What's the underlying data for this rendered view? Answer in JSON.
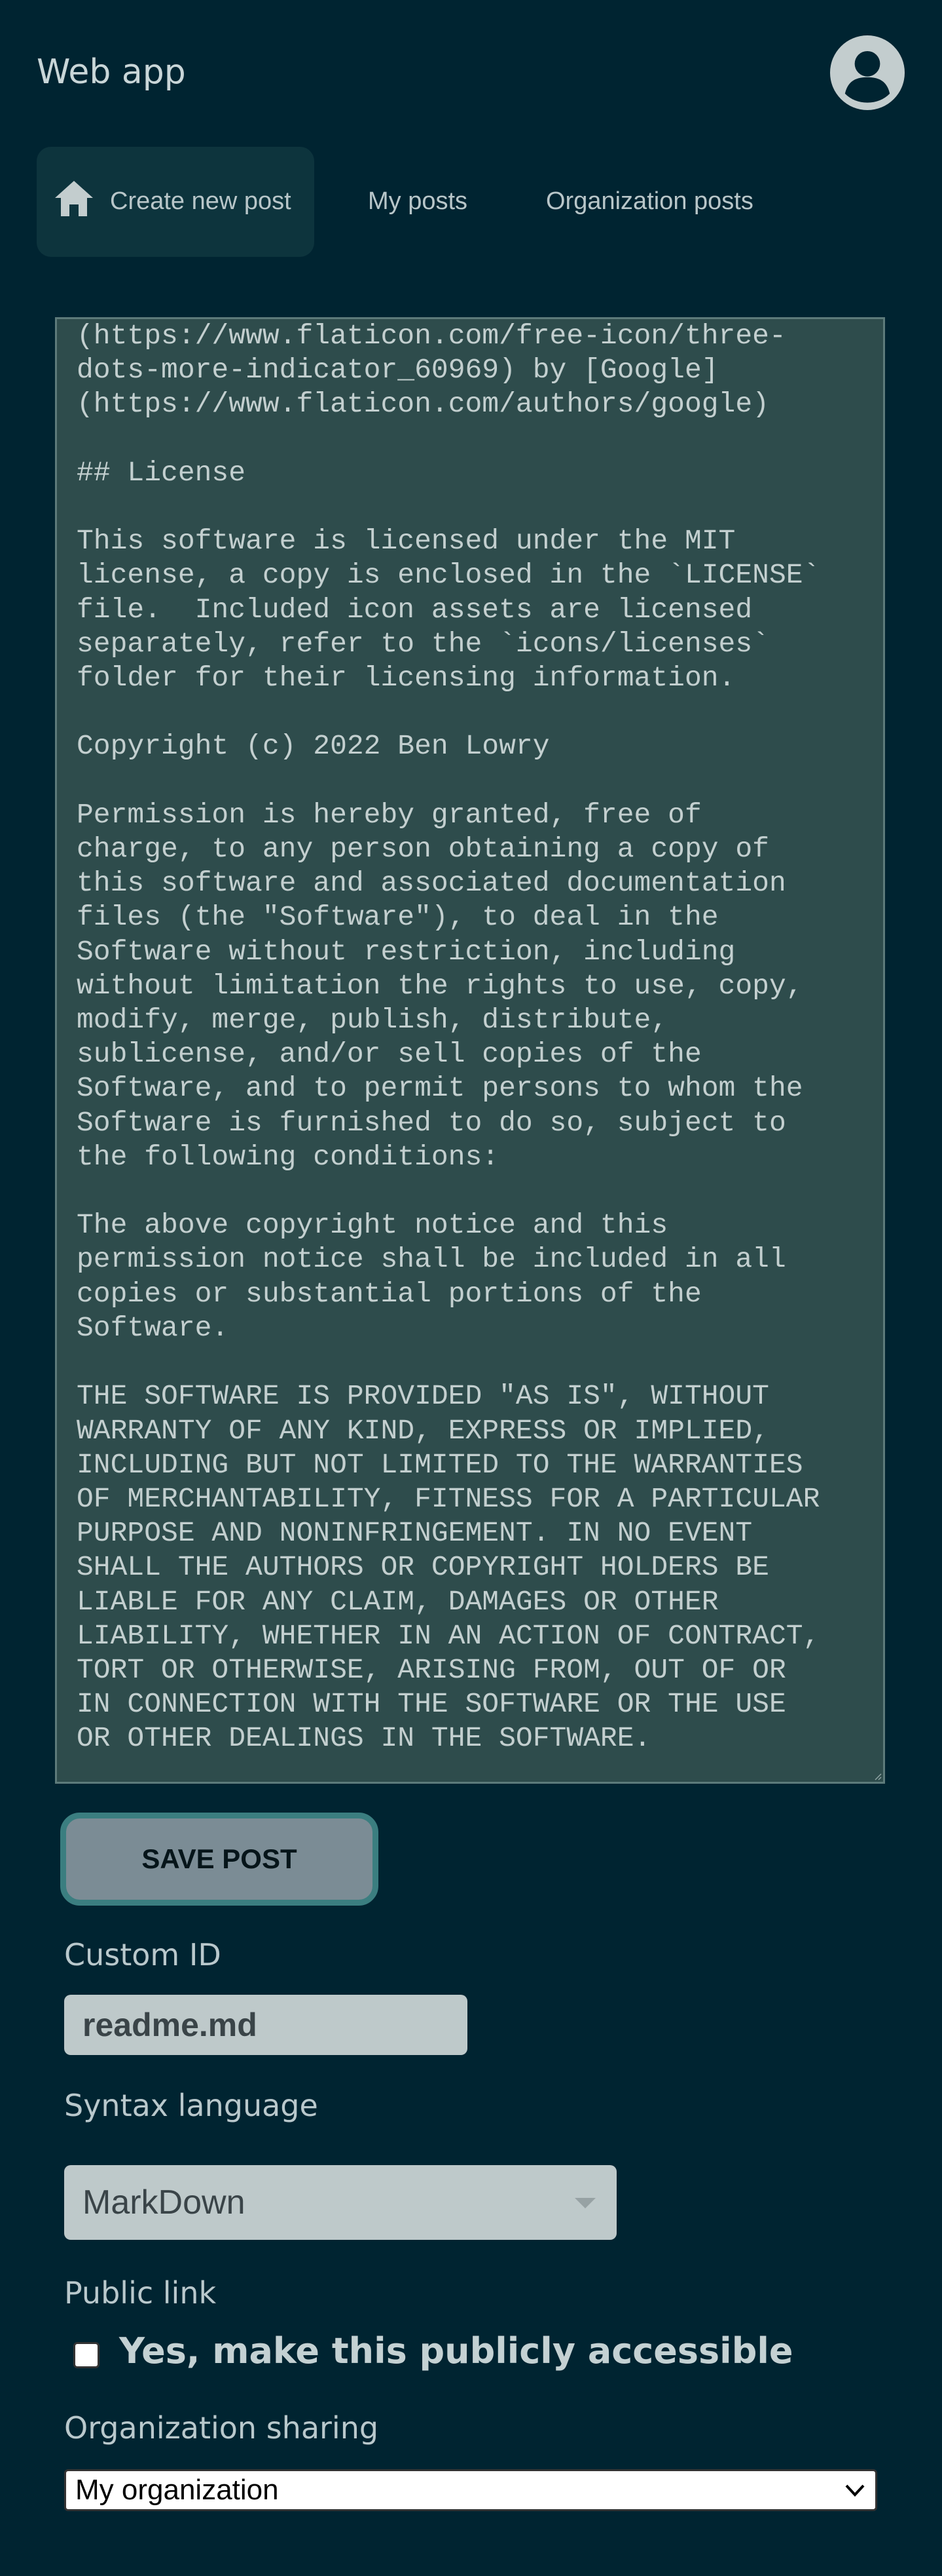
{
  "app": {
    "title": "Web app"
  },
  "nav": {
    "tabs": [
      {
        "label": "Create new post",
        "icon": "home-icon",
        "active": true
      },
      {
        "label": "My posts",
        "active": false
      },
      {
        "label": "Organization posts",
        "active": false
      }
    ]
  },
  "editor": {
    "content": "(https://www.flaticon.com/free-icon/three-\ndots-more-indicator_60969) by [Google]\n(https://www.flaticon.com/authors/google)\n\n## License\n\nThis software is licensed under the MIT\nlicense, a copy is enclosed in the `LICENSE`\nfile.  Included icon assets are licensed\nseparately, refer to the `icons/licenses`\nfolder for their licensing information.\n\nCopyright (c) 2022 Ben Lowry\n\nPermission is hereby granted, free of\ncharge, to any person obtaining a copy of\nthis software and associated documentation\nfiles (the \"Software\"), to deal in the\nSoftware without restriction, including\nwithout limitation the rights to use, copy,\nmodify, merge, publish, distribute,\nsublicense, and/or sell copies of the\nSoftware, and to permit persons to whom the\nSoftware is furnished to do so, subject to\nthe following conditions:\n\nThe above copyright notice and this\npermission notice shall be included in all\ncopies or substantial portions of the\nSoftware.\n\nTHE SOFTWARE IS PROVIDED \"AS IS\", WITHOUT\nWARRANTY OF ANY KIND, EXPRESS OR IMPLIED,\nINCLUDING BUT NOT LIMITED TO THE WARRANTIES\nOF MERCHANTABILITY, FITNESS FOR A PARTICULAR\nPURPOSE AND NONINFRINGEMENT. IN NO EVENT\nSHALL THE AUTHORS OR COPYRIGHT HOLDERS BE\nLIABLE FOR ANY CLAIM, DAMAGES OR OTHER\nLIABILITY, WHETHER IN AN ACTION OF CONTRACT,\nTORT OR OTHERWISE, ARISING FROM, OUT OF OR\nIN CONNECTION WITH THE SOFTWARE OR THE USE\nOR OTHER DEALINGS IN THE SOFTWARE."
  },
  "form": {
    "save_label": "SAVE POST",
    "custom_id_label": "Custom ID",
    "custom_id_value": "readme.md",
    "syntax_label": "Syntax language",
    "syntax_value": "MarkDown",
    "public_label": "Public link",
    "public_checkbox_label": "Yes, make this publicly accessible",
    "public_checked": false,
    "org_sharing_label": "Organization sharing",
    "org_sharing_value": "My organization"
  },
  "colors": {
    "background": "#002431",
    "active_tab": "#0d343d",
    "editor_bg": "#2e4c4c",
    "save_button_bg": "#7b8c95",
    "save_button_border": "#3b7e80",
    "input_bg": "#bec9ca"
  }
}
